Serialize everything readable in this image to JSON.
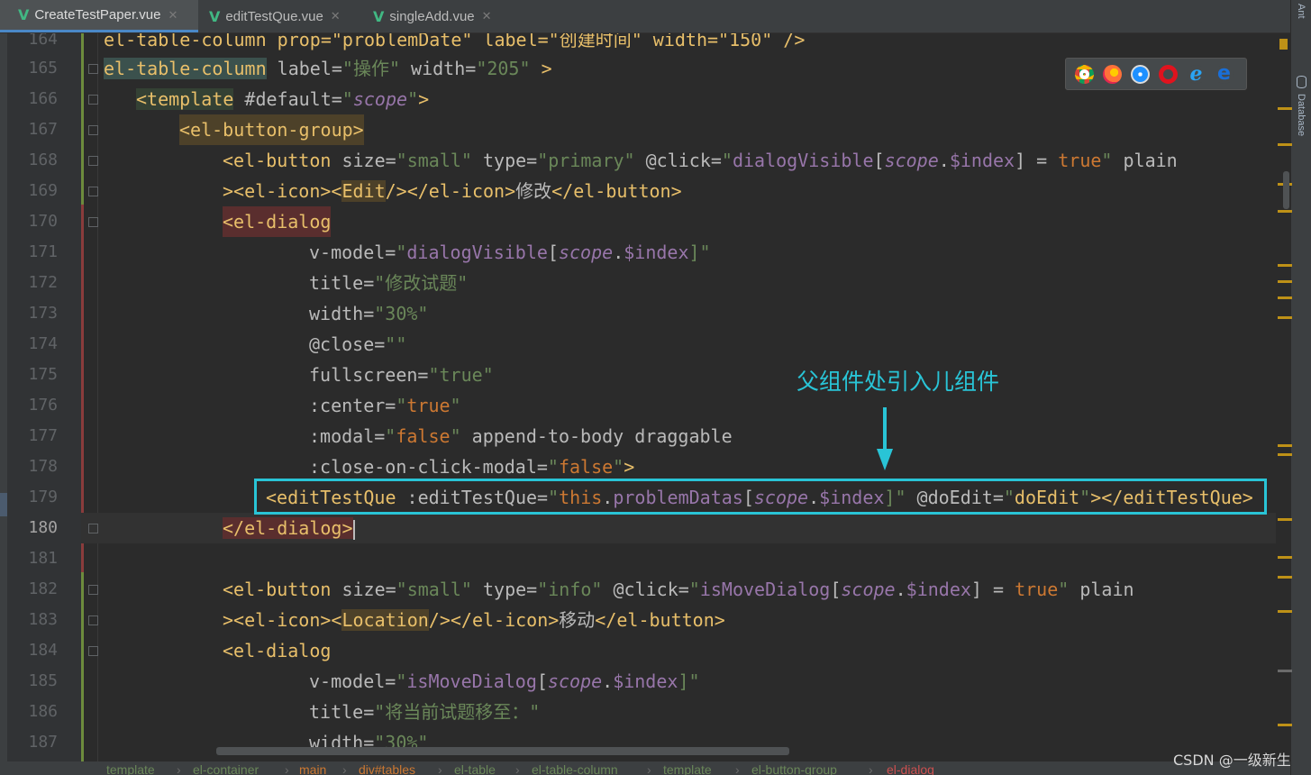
{
  "tabs": [
    {
      "label": "CreateTestPaper.vue",
      "active": true
    },
    {
      "label": "editTestQue.vue",
      "active": false
    },
    {
      "label": "singleAdd.vue",
      "active": false
    }
  ],
  "right_tools": [
    "Ant",
    "Database"
  ],
  "lines": {
    "n164": "164",
    "n165": "165",
    "n166": "166",
    "n167": "167",
    "n168": "168",
    "n169": "169",
    "n170": "170",
    "n171": "171",
    "n172": "172",
    "n173": "173",
    "n174": "174",
    "n175": "175",
    "n176": "176",
    "n177": "177",
    "n178": "178",
    "n179": "179",
    "n180": "180",
    "n181": "181",
    "n182": "182",
    "n183": "183",
    "n184": "184",
    "n185": "185",
    "n186": "186",
    "n187": "187"
  },
  "code": {
    "l164": "el-table-column prop=\"problemDate\" label=\"创建时间\" width=\"150\" />",
    "l165_tag": "el-table-column",
    "l165_attr": "label=",
    "l165_v1": "\"操作\"",
    "l165_attr2": " width=",
    "l165_v2": "\"205\"",
    "l165_end": " >",
    "l166_tag": "<template",
    "l166_attr": " #default=",
    "l166_q1": "\"",
    "l166_var": "scope",
    "l166_q2": "\"",
    "l166_end": ">",
    "l167": "<el-button-group>",
    "l168_tag": "<el-button",
    "l168_a1": " size=",
    "l168_v1": "\"small\"",
    "l168_a2": " type=",
    "l168_v2": "\"primary\"",
    "l168_a3": " @click=",
    "l168_q": "\"",
    "l168_fn": "dialogVisible",
    "l168_b1": "[",
    "l168_scope": "scope",
    "l168_dot": ".",
    "l168_idx": "$index",
    "l168_b2": "] = ",
    "l168_true": "true",
    "l168_q2": "\"",
    "l168_plain": " plain",
    "l169_a": "><el-icon><",
    "l169_edit": "Edit",
    "l169_b": "/></el-icon>",
    "l169_txt": "修改",
    "l169_c": "</el-button>",
    "l170": "<el-dialog",
    "l171_a": "v-model=",
    "l171_q": "\"",
    "l171_fn": "dialogVisible",
    "l171_b1": "[",
    "l171_scope": "scope",
    "l171_dot": ".",
    "l171_idx": "$index",
    "l171_b2": "]\"",
    "l172_a": "title=",
    "l172_v": "\"修改试题\"",
    "l173_a": "width=",
    "l173_v": "\"30%\"",
    "l174_a": "@close=",
    "l174_v": "\"\"",
    "l175_a": "fullscreen=",
    "l175_v": "\"true\"",
    "l176_a": ":center=",
    "l176_q": "\"",
    "l176_v": "true",
    "l176_q2": "\"",
    "l177_a": ":modal=",
    "l177_q": "\"",
    "l177_v": "false",
    "l177_q2": "\"",
    "l177_rest": " append-to-body draggable",
    "l178_a": ":close-on-click-modal=",
    "l178_q": "\"",
    "l178_v": "false",
    "l178_q2": "\"",
    "l178_end": ">",
    "l179_tag": "<editTestQue",
    "l179_a": " :editTestQue=",
    "l179_q": "\"",
    "l179_this": "this",
    "l179_dot1": ".",
    "l179_prop": "problemDatas",
    "l179_b1": "[",
    "l179_scope": "scope",
    "l179_dot2": ".",
    "l179_idx": "$index",
    "l179_b2": "]\"",
    "l179_a2": " @doEdit=",
    "l179_q3": "\"",
    "l179_fn": "doEdit",
    "l179_q4": "\"",
    "l179_end": "></editTestQue>",
    "l180": "</el-dialog>",
    "l182_tag": "<el-button",
    "l182_a1": " size=",
    "l182_v1": "\"small\"",
    "l182_a2": " type=",
    "l182_v2": "\"info\"",
    "l182_a3": " @click=",
    "l182_q": "\"",
    "l182_fn": "isMoveDialog",
    "l182_b1": "[",
    "l182_scope": "scope",
    "l182_dot": ".",
    "l182_idx": "$index",
    "l182_b2": "] = ",
    "l182_true": "true",
    "l182_q2": "\"",
    "l182_plain": " plain",
    "l183_a": "><el-icon><",
    "l183_loc": "Location",
    "l183_b": "/></el-icon>",
    "l183_txt": "移动",
    "l183_c": "</el-button>",
    "l184": "<el-dialog",
    "l185_a": "v-model=",
    "l185_q": "\"",
    "l185_fn": "isMoveDialog",
    "l185_b1": "[",
    "l185_scope": "scope",
    "l185_dot": ".",
    "l185_idx": "$index",
    "l185_b2": "]\"",
    "l186_a": "title=",
    "l186_v": "\"将当前试题移至：\"",
    "l187_a": "width=",
    "l187_v": "\"30%\""
  },
  "annotation": "父组件处引入儿组件",
  "breadcrumbs": [
    "template",
    "el-container",
    "main",
    "div#tables",
    "el-table",
    "el-table-column",
    "template",
    "el-button-group",
    "el-dialog"
  ],
  "breadcrumb_sep": "›",
  "watermark": "CSDN @一级新生",
  "browser_icons": [
    "chrome-icon",
    "firefox-icon",
    "safari-icon",
    "opera-icon",
    "ie-icon",
    "edge-icon"
  ],
  "colors": {
    "accent": "#29c4d6",
    "tag": "#e8bf6a",
    "string": "#6a8759",
    "keyword": "#cc7832",
    "variable": "#9876aa"
  }
}
